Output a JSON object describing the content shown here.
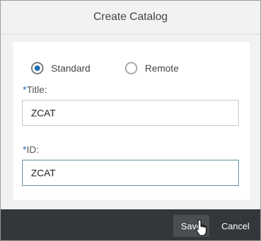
{
  "dialog": {
    "title": "Create Catalog",
    "radios": [
      {
        "label": "Standard",
        "selected": true
      },
      {
        "label": "Remote",
        "selected": false
      }
    ],
    "title_field": {
      "required_mark": "*",
      "label": "Title:",
      "value": "ZCAT"
    },
    "id_field": {
      "required_mark": "*",
      "label": "ID:",
      "value": "ZCAT"
    },
    "footer": {
      "save_label": "Save",
      "cancel_label": "Cancel"
    }
  },
  "colors": {
    "footer_bg": "#33373b",
    "accent": "#1f6fb2"
  },
  "icons": {
    "cursor": "hand-pointer-icon",
    "radio_selected": "radio-checked-icon",
    "radio_unselected": "radio-unchecked-icon"
  }
}
